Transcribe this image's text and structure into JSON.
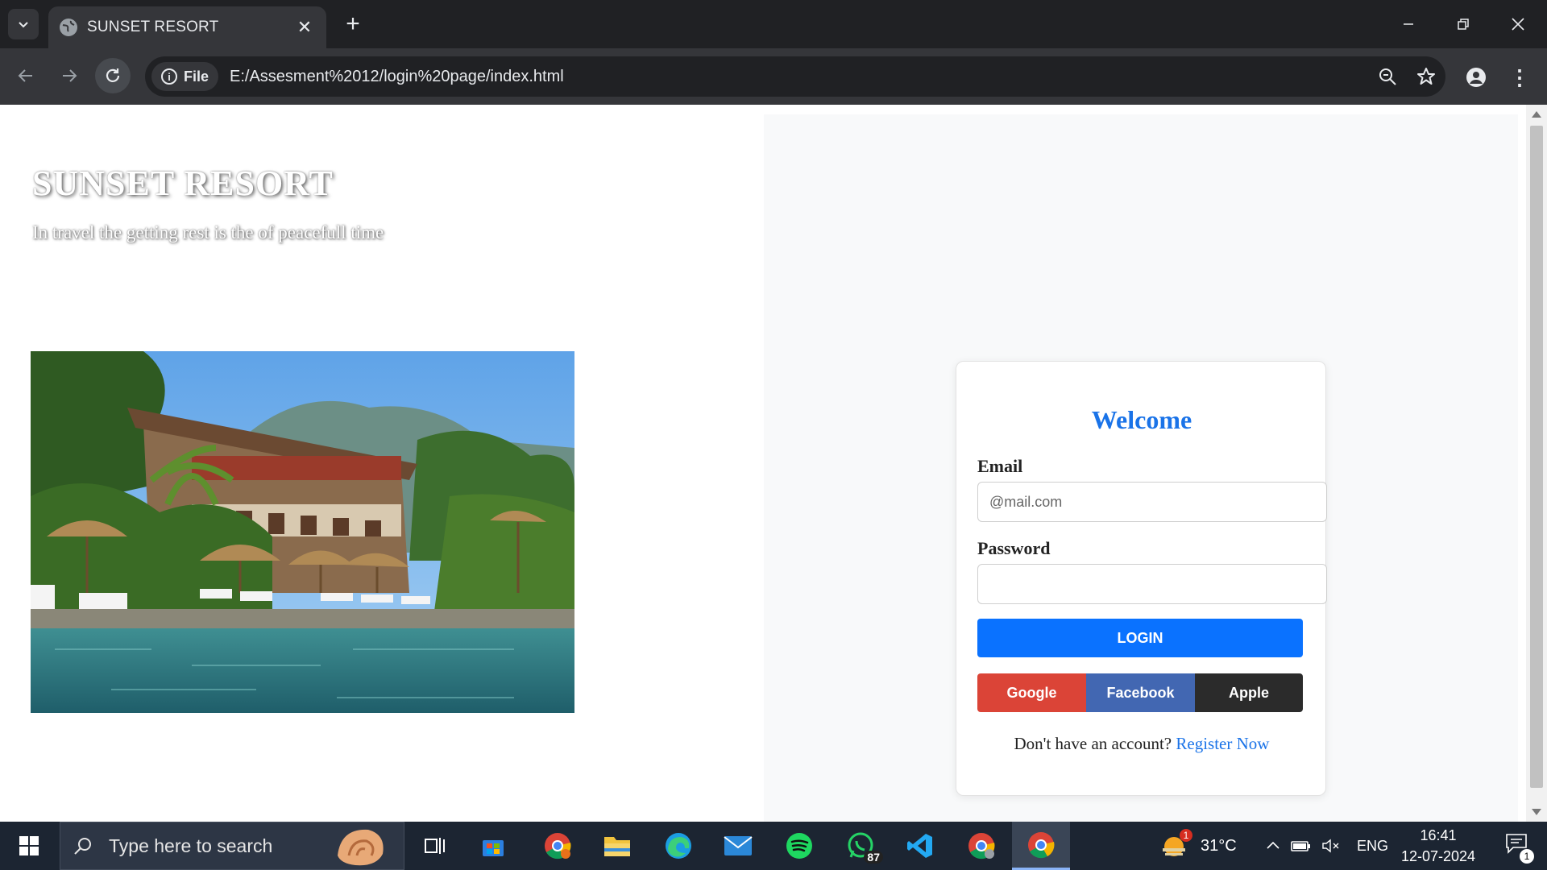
{
  "browser": {
    "tab_title": "SUNSET RESORT",
    "chip_label": "File",
    "url": "E:/Assesment%2012/login%20page/index.html"
  },
  "page": {
    "brand_title": "SUNSET RESORT",
    "tagline": "In travel the getting rest is the of peacefull time",
    "photo_alt": "resort-pool-photo"
  },
  "login": {
    "heading": "Welcome",
    "email_label": "Email",
    "email_placeholder": "@mail.com",
    "password_label": "Password",
    "password_value": "",
    "login_button": "LOGIN",
    "social": [
      {
        "label": "Google",
        "color": "#db4437"
      },
      {
        "label": "Facebook",
        "color": "#4267b2"
      },
      {
        "label": "Apple",
        "color": "#2b2b2b"
      }
    ],
    "register_prompt": "Don't have an account? ",
    "register_link": "Register Now",
    "accent_color": "#1a73e8",
    "button_color": "#0a72ff"
  },
  "taskbar": {
    "search_placeholder": "Type here to search",
    "whatsapp_badge": "87",
    "weather_badge": "1",
    "temperature": "31°C",
    "language": "ENG",
    "time": "16:41",
    "date": "12-07-2024",
    "notifications_count": "1"
  }
}
